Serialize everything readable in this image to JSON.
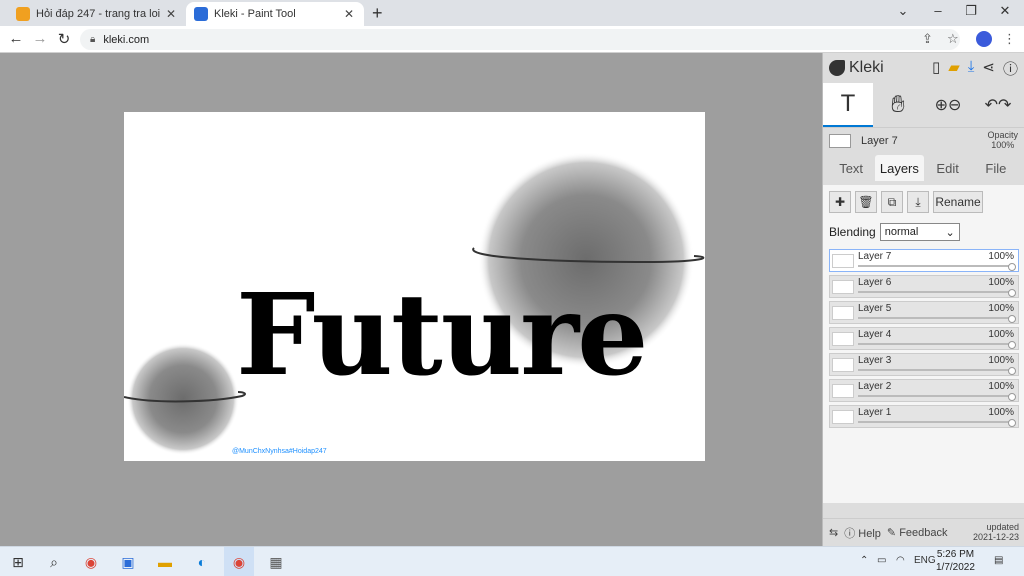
{
  "browser": {
    "tabs": [
      {
        "title": "Hỏi đáp 247 - trang tra loi",
        "active": false
      },
      {
        "title": "Kleki - Paint Tool",
        "active": true
      }
    ],
    "url": "kleki.com"
  },
  "canvas": {
    "text": "Future",
    "watermark": "@MunChxNynhsa#Hoidap247"
  },
  "panel": {
    "app_name": "Kleki",
    "current_layer": "Layer 7",
    "opacity_label": "Opacity",
    "opacity_value": "100%",
    "tabs": [
      "Text",
      "Layers",
      "Edit",
      "File"
    ],
    "active_tab": "Layers",
    "rename_label": "Rename",
    "blending_label": "Blending",
    "blending_value": "normal",
    "layers": [
      {
        "name": "Layer 7",
        "opacity": "100%",
        "selected": true
      },
      {
        "name": "Layer 6",
        "opacity": "100%",
        "selected": false
      },
      {
        "name": "Layer 5",
        "opacity": "100%",
        "selected": false
      },
      {
        "name": "Layer 4",
        "opacity": "100%",
        "selected": false
      },
      {
        "name": "Layer 3",
        "opacity": "100%",
        "selected": false
      },
      {
        "name": "Layer 2",
        "opacity": "100%",
        "selected": false
      },
      {
        "name": "Layer 1",
        "opacity": "100%",
        "selected": false
      }
    ],
    "footer": {
      "help": "Help",
      "feedback": "Feedback",
      "updated_label": "updated",
      "updated_date": "2021-12-23"
    }
  },
  "taskbar": {
    "language": "ENG",
    "time": "5:26 PM",
    "date": "1/7/2022"
  }
}
